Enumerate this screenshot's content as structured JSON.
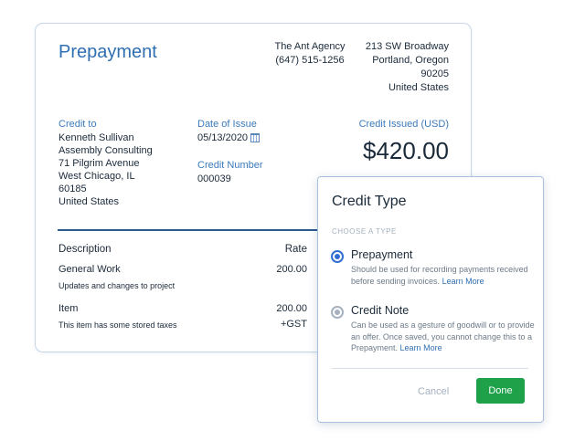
{
  "invoice": {
    "title": "Prepayment",
    "agency": {
      "name": "The Ant Agency",
      "phone": "(647) 515-1256"
    },
    "address": {
      "line1": "213 SW Broadway",
      "line2": "Portland, Oregon",
      "line3": "90205",
      "line4": "United States"
    },
    "credit_to": {
      "label": "Credit to",
      "lines": [
        "Kenneth Sullivan",
        "Assembly Consulting",
        "71 Pilgrim Avenue",
        "West Chicago, IL",
        "60185",
        "United States"
      ]
    },
    "date_of_issue": {
      "label": "Date of Issue",
      "value": "05/13/2020"
    },
    "credit_number": {
      "label": "Credit Number",
      "value": "000039"
    },
    "credit_issued": {
      "label": "Credit Issued (USD)",
      "amount": "$420.00"
    },
    "table": {
      "headers": {
        "description": "Description",
        "rate": "Rate"
      },
      "rows": [
        {
          "description": "General Work",
          "rate": "200.00",
          "detail": "Updates and changes to project"
        },
        {
          "description": "Item",
          "rate": "200.00",
          "detail": "This item has some stored taxes",
          "tax": "+GST"
        }
      ]
    }
  },
  "modal": {
    "title": "Credit Type",
    "caption": "CHOOSE A TYPE",
    "options": [
      {
        "title": "Prepayment",
        "desc": "Should be used for recording payments received before sending invoices.",
        "link": "Learn More",
        "selected": true
      },
      {
        "title": "Credit Note",
        "desc": "Can be used as a gesture of goodwill or to provide an offer. Once saved, you cannot change this to a Prepayment.",
        "link": "Learn More",
        "selected": false
      }
    ],
    "cancel_label": "Cancel",
    "done_label": "Done",
    "colors": {
      "accent": "#2f6fd0",
      "done": "#1fa14a"
    }
  }
}
